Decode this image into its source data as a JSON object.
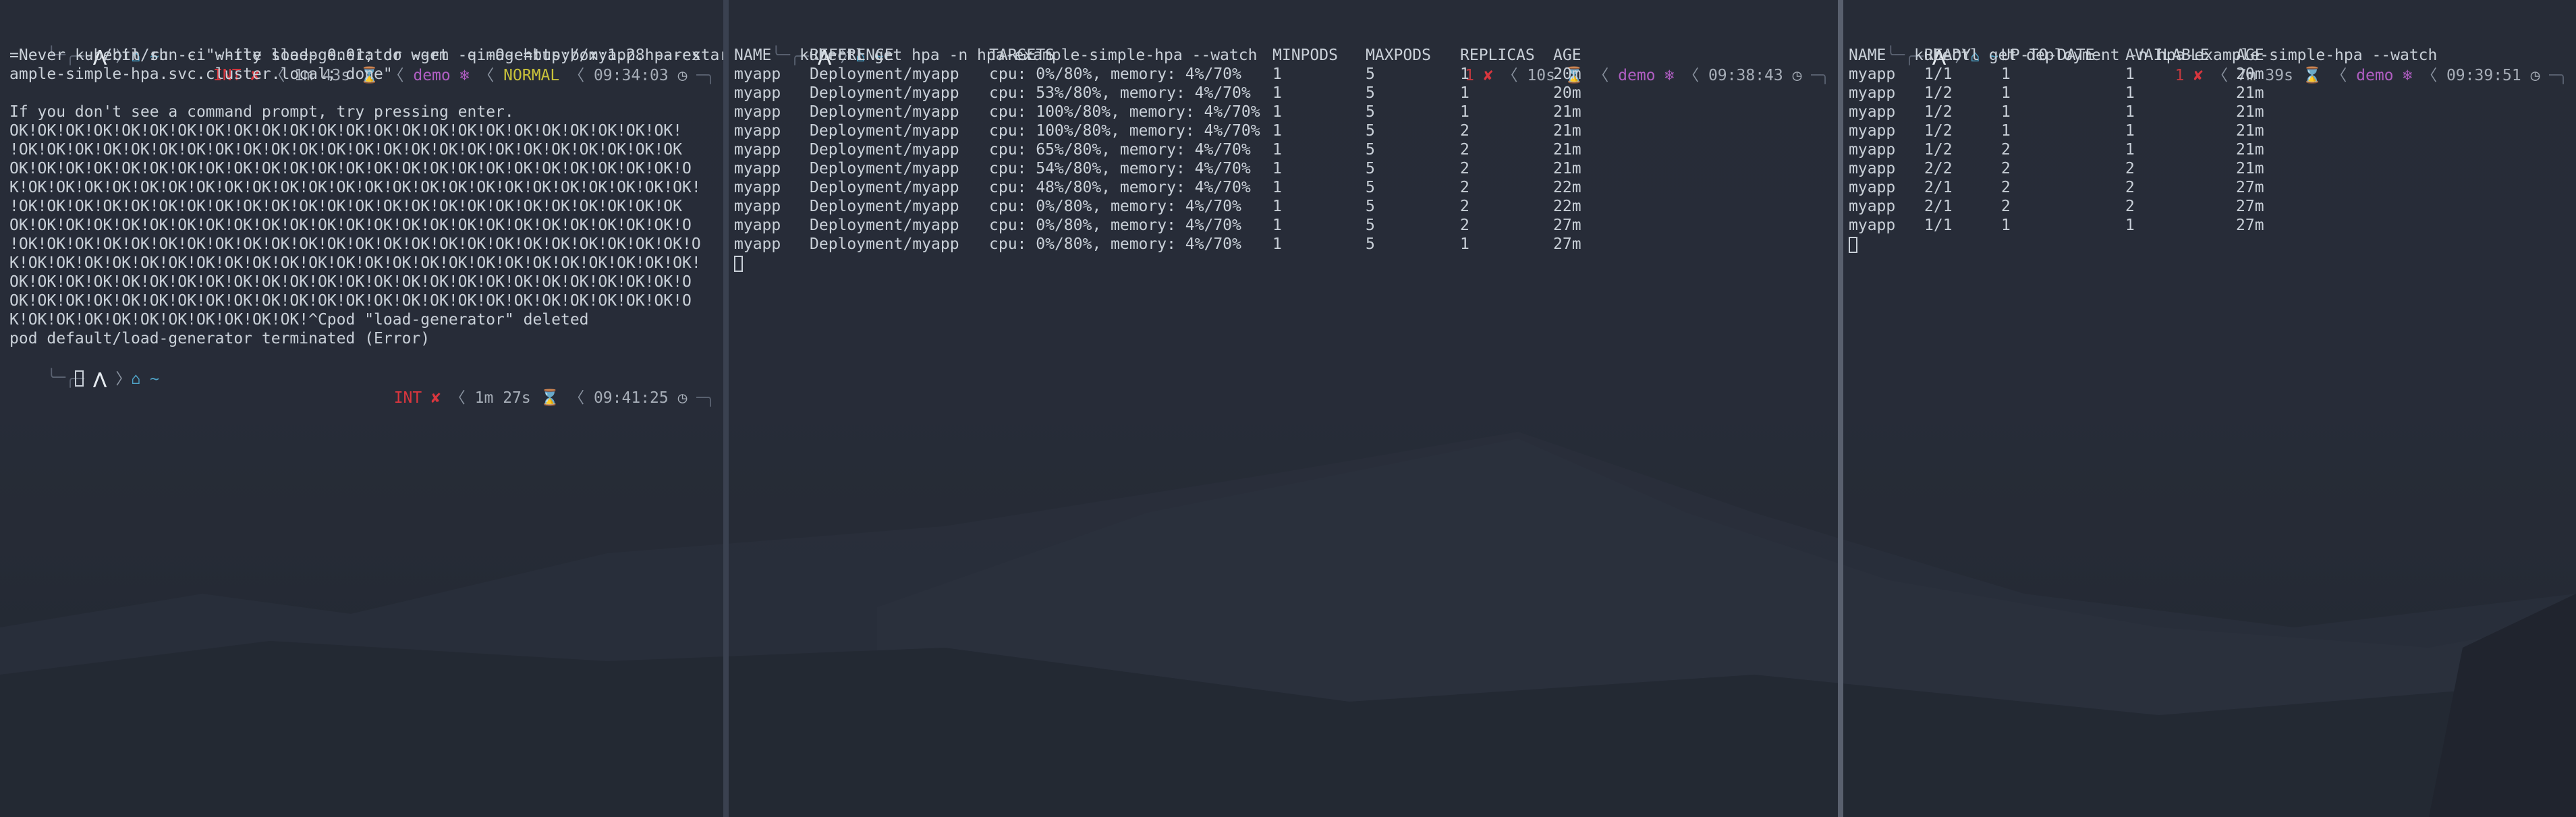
{
  "left": {
    "prompt1": {
      "home": "~",
      "status": "INT",
      "duration": "1m 43s",
      "context": "demo",
      "mode": "NORMAL",
      "time": "09:34:03"
    },
    "command_lines": [
      "kubectl run -i --tty load-generator --rm --image=busybox:1.28 --restart",
      "=Never -- /bin/sh -c \"while sleep 0.01; do wget -q -O- http://myapp.hpa-ex",
      "ample-simple-hpa.svc.cluster.local; done\""
    ],
    "output_lines": [
      "",
      "If you don't see a command prompt, try pressing enter.",
      "OK!OK!OK!OK!OK!OK!OK!OK!OK!OK!OK!OK!OK!OK!OK!OK!OK!OK!OK!OK!OK!OK!OK!OK!",
      "!OK!OK!OK!OK!OK!OK!OK!OK!OK!OK!OK!OK!OK!OK!OK!OK!OK!OK!OK!OK!OK!OK!OK!OK",
      "OK!OK!OK!OK!OK!OK!OK!OK!OK!OK!OK!OK!OK!OK!OK!OK!OK!OK!OK!OK!OK!OK!OK!OK!O",
      "K!OK!OK!OK!OK!OK!OK!OK!OK!OK!OK!OK!OK!OK!OK!OK!OK!OK!OK!OK!OK!OK!OK!OK!OK!",
      "!OK!OK!OK!OK!OK!OK!OK!OK!OK!OK!OK!OK!OK!OK!OK!OK!OK!OK!OK!OK!OK!OK!OK!OK",
      "OK!OK!OK!OK!OK!OK!OK!OK!OK!OK!OK!OK!OK!OK!OK!OK!OK!OK!OK!OK!OK!OK!OK!OK!O",
      "!OK!OK!OK!OK!OK!OK!OK!OK!OK!OK!OK!OK!OK!OK!OK!OK!OK!OK!OK!OK!OK!OK!OK!OK!O",
      "K!OK!OK!OK!OK!OK!OK!OK!OK!OK!OK!OK!OK!OK!OK!OK!OK!OK!OK!OK!OK!OK!OK!OK!OK!",
      "OK!OK!OK!OK!OK!OK!OK!OK!OK!OK!OK!OK!OK!OK!OK!OK!OK!OK!OK!OK!OK!OK!OK!OK!O",
      "OK!OK!OK!OK!OK!OK!OK!OK!OK!OK!OK!OK!OK!OK!OK!OK!OK!OK!OK!OK!OK!OK!OK!OK!O",
      "K!OK!OK!OK!OK!OK!OK!OK!OK!OK!OK!^Cpod \"load-generator\" deleted",
      "pod default/load-generator terminated (Error)"
    ],
    "prompt2": {
      "home": "~",
      "status": "INT",
      "duration": "1m 27s",
      "time": "09:41:25"
    }
  },
  "middle": {
    "prompt": {
      "home": "~",
      "status_code": "1",
      "duration": "10s",
      "context": "demo",
      "time": "09:38:43"
    },
    "command": "kubectl get hpa -n hpa-example-simple-hpa --watch",
    "headers": [
      "NAME",
      "REFERENCE",
      "TARGETS",
      "MINPODS",
      "MAXPODS",
      "REPLICAS",
      "AGE"
    ],
    "rows": [
      [
        "myapp",
        "Deployment/myapp",
        "cpu: 0%/80%, memory: 4%/70%",
        "1",
        "5",
        "1",
        "20m"
      ],
      [
        "myapp",
        "Deployment/myapp",
        "cpu: 53%/80%, memory: 4%/70%",
        "1",
        "5",
        "1",
        "20m"
      ],
      [
        "myapp",
        "Deployment/myapp",
        "cpu: 100%/80%, memory: 4%/70%",
        "1",
        "5",
        "1",
        "21m"
      ],
      [
        "myapp",
        "Deployment/myapp",
        "cpu: 100%/80%, memory: 4%/70%",
        "1",
        "5",
        "2",
        "21m"
      ],
      [
        "myapp",
        "Deployment/myapp",
        "cpu: 65%/80%, memory: 4%/70%",
        "1",
        "5",
        "2",
        "21m"
      ],
      [
        "myapp",
        "Deployment/myapp",
        "cpu: 54%/80%, memory: 4%/70%",
        "1",
        "5",
        "2",
        "21m"
      ],
      [
        "myapp",
        "Deployment/myapp",
        "cpu: 48%/80%, memory: 4%/70%",
        "1",
        "5",
        "2",
        "22m"
      ],
      [
        "myapp",
        "Deployment/myapp",
        "cpu: 0%/80%, memory: 4%/70%",
        "1",
        "5",
        "2",
        "22m"
      ],
      [
        "myapp",
        "Deployment/myapp",
        "cpu: 0%/80%, memory: 4%/70%",
        "1",
        "5",
        "2",
        "27m"
      ],
      [
        "myapp",
        "Deployment/myapp",
        "cpu: 0%/80%, memory: 4%/70%",
        "1",
        "5",
        "1",
        "27m"
      ]
    ]
  },
  "right": {
    "prompt": {
      "home": "~",
      "status_code": "1",
      "duration": "7m 39s",
      "context": "demo",
      "time": "09:39:51"
    },
    "command": "kubectl get deployment -n hpa-example-simple-hpa --watch",
    "headers": [
      "NAME",
      "READY",
      "UP-TO-DATE",
      "AVAILABLE",
      "AGE"
    ],
    "rows": [
      [
        "myapp",
        "1/1",
        "1",
        "1",
        "20m"
      ],
      [
        "myapp",
        "1/2",
        "1",
        "1",
        "21m"
      ],
      [
        "myapp",
        "1/2",
        "1",
        "1",
        "21m"
      ],
      [
        "myapp",
        "1/2",
        "1",
        "1",
        "21m"
      ],
      [
        "myapp",
        "1/2",
        "2",
        "1",
        "21m"
      ],
      [
        "myapp",
        "2/2",
        "2",
        "2",
        "21m"
      ],
      [
        "myapp",
        "2/1",
        "2",
        "2",
        "27m"
      ],
      [
        "myapp",
        "2/1",
        "2",
        "2",
        "27m"
      ],
      [
        "myapp",
        "1/1",
        "1",
        "1",
        "27m"
      ]
    ]
  },
  "icons": {
    "arch": "arch-linux-icon",
    "home": "home-icon",
    "error": "cross-icon",
    "timer": "hourglass-icon",
    "context": "snowflake-icon",
    "clock": "clock-icon"
  },
  "colors": {
    "background": "#262d38",
    "text": "#c9d0d8",
    "error": "#d9363e",
    "context": "#b05ec2",
    "mode": "#c9c23a",
    "home": "#4fa3c7"
  }
}
